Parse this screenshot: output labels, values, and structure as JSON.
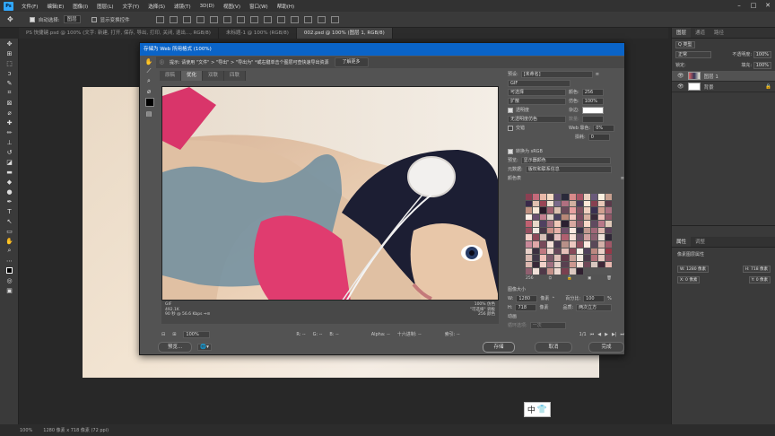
{
  "menu": {
    "items": [
      "文件(F)",
      "编辑(E)",
      "图像(I)",
      "图层(L)",
      "文字(Y)",
      "选择(S)",
      "滤镜(T)",
      "3D(D)",
      "视图(V)",
      "窗口(W)",
      "帮助(H)"
    ]
  },
  "options": {
    "auto_select": "自动选择:",
    "auto_select_target": "图层",
    "show_transform": "显示变换控件"
  },
  "doc_tabs": [
    {
      "label": "PS 快捷键.psd @ 100% (文字: 新建, 打开, 保存, 导出, 打印, 关闭, 退出..., RGB/8)"
    },
    {
      "label": "未标题-1 @ 100% (RGB/8)"
    },
    {
      "label": "002.psd @ 100% (图层 1, RGB/8)"
    }
  ],
  "dialog": {
    "title": "存储为 Web 所用格式 (100%)",
    "hint": "提示:  请使用 \"文件\" > \"导出\" > \"导出为\"  *或右键单击个图层可查快速导出资源",
    "learn_more": "了解更多",
    "view_tabs": [
      "原稿",
      "优化",
      "双联",
      "四联"
    ],
    "preview_info_left": [
      "GIF",
      "492.1K",
      "90 秒 @ 56.6 Kbps  ⇒≡"
    ],
    "preview_info_right": [
      "100% 仿色",
      "\"可选择\" 调板",
      "256 颜色"
    ],
    "zoom": "100%",
    "r_label": "R: --",
    "g_label": "G: --",
    "b_label": "B: --",
    "alpha_label": "Alpha: --",
    "hex_label": "十六进制: --",
    "index_label": "索引: --",
    "preview_btn": "预览...",
    "save_btn": "存储",
    "cancel_btn": "取消",
    "done_btn": "完成"
  },
  "settings": {
    "preset_label": "预设:",
    "preset_value": "[未命名]",
    "format": "GIF",
    "reduction": "可选择",
    "colors_label": "颜色:",
    "colors_value": "256",
    "dither_algo": "扩散",
    "dither_label": "仿色:",
    "dither_value": "100%",
    "transparency": "透明度",
    "matte_label": "杂边:",
    "trans_dither": "无透明度仿色",
    "amount_label": "数量:",
    "interlaced": "交错",
    "web_snap_label": "Web 靠色:",
    "web_snap_value": "0%",
    "lossy_label": "损耗:",
    "lossy_value": "0",
    "convert_srgb": "转换为 sRGB",
    "preview_label": "预览:",
    "preview_value": "显示器颜色",
    "metadata_label": "元数据:",
    "metadata_value": "版权和联系信息",
    "color_table_label": "颜色表",
    "color_count": "256",
    "image_size_label": "图像大小",
    "width_label": "W:",
    "width_value": "1280",
    "height_label": "H:",
    "height_value": "718",
    "px_unit": "像素",
    "percent_label": "百分比:",
    "percent_value": "100",
    "quality_label": "品质:",
    "quality_value": "两次立方",
    "animation_label": "动画",
    "loop_label": "循环选项:",
    "loop_value": "一次",
    "frame_counter": "1/1"
  },
  "color_table": [
    "#8b3f52",
    "#c46a7a",
    "#e8b8a8",
    "#f4d9c4",
    "#5a4a6a",
    "#2a2a3a",
    "#d88a8a",
    "#aa5566",
    "#ecd0c0",
    "#6a5a7a",
    "#faf0e0",
    "#c8a090",
    "#3a2a4a",
    "#e0c0b0",
    "#994455",
    "#f0e0d0",
    "#7a6a8a",
    "#b07080",
    "#d0b0a0",
    "#4a3a5a",
    "#ffe8d8",
    "#884050",
    "#e8c8b8",
    "#5a3a4a",
    "#c09080",
    "#f8e8d8",
    "#2a1a2a",
    "#a06070",
    "#dcc0b0",
    "#6a4a5a",
    "#e8a0a0",
    "#805060",
    "#f0d0c0",
    "#3a3050",
    "#d0a090",
    "#aa7080",
    "#fff0e8",
    "#6a5070",
    "#c48090",
    "#e0d0c8",
    "#4a4060",
    "#b88878",
    "#f4c8c0",
    "#7a4a60",
    "#d8b0a0",
    "#3a2a3a",
    "#eec0b8",
    "#905868",
    "#c06070",
    "#e8d8c8",
    "#504060",
    "#a47080",
    "#f0c8b8",
    "#2a2030",
    "#d8a8a0",
    "#8a5a6a",
    "#f8d8c8",
    "#604a60",
    "#b87888",
    "#e0c8b8",
    "#985060",
    "#f0e8e0",
    "#4a3848",
    "#cc9088",
    "#e8b0a8",
    "#70506a",
    "#fae8e0",
    "#383048",
    "#c09890",
    "#a06878",
    "#e0b8b0",
    "#5a4058",
    "#f4d0c8",
    "#8c4858",
    "#d8c0b8",
    "#403040",
    "#e8c0c0",
    "#b06070",
    "#f8e0d8",
    "#6a5068",
    "#d0a0a0",
    "#8a6070",
    "#ece0d8",
    "#302838",
    "#c88898",
    "#e0a8a8",
    "#784a5a",
    "#f4e0d8",
    "#4a3a50",
    "#b89088",
    "#ecc8c0",
    "#905060",
    "#fce8e0",
    "#5a4858",
    "#d4b0a8",
    "#a05868",
    "#e8d0c8",
    "#3a3040",
    "#c07880",
    "#f0d8d0",
    "#68485a",
    "#e4c0b8",
    "#884858",
    "#f8f0e8",
    "#50405a",
    "#bc8880",
    "#ecd0c8",
    "#983848",
    "#d8b8b0",
    "#403848",
    "#f0c0b8",
    "#7a5868",
    "#e0c0b8",
    "#603848",
    "#c8a098",
    "#f4e8e0",
    "#483848",
    "#b07078",
    "#e8c8c0",
    "#8a5060",
    "#dcb8b0",
    "#382838",
    "#f0d0c8",
    "#a07080",
    "#e4d0c8",
    "#584050",
    "#cc9890",
    "#f8e0d8",
    "#704858",
    "#d8c8c0",
    "#402838",
    "#e8b8b0",
    "#906070",
    "#f0e0d8",
    "#503848",
    "#c49088",
    "#ecd8d0",
    "#7a4050",
    "#dcc8c0",
    "#302030"
  ],
  "layers_panel": {
    "tabs": [
      "图层",
      "通道",
      "路径"
    ],
    "kind_label": "Q 类型",
    "blend_mode": "正常",
    "opacity_label": "不透明度:",
    "opacity_value": "100%",
    "lock_label": "锁定:",
    "fill_label": "填充:",
    "fill_value": "100%",
    "layers": [
      "图层 1",
      "背景"
    ]
  },
  "props_panel": {
    "tabs": [
      "属性",
      "调整"
    ],
    "title": "像素图层属性",
    "w_label": "W: 1280 像素",
    "h_label": "H: 718 像素",
    "x_label": "X: 0 像素",
    "y_label": "Y: 0 像素"
  },
  "status": {
    "zoom": "100%",
    "doc_size": "1280 像素 x 718 像素 (72 ppi)"
  },
  "ime": {
    "lang": "中",
    "icon": "shirt-icon"
  }
}
